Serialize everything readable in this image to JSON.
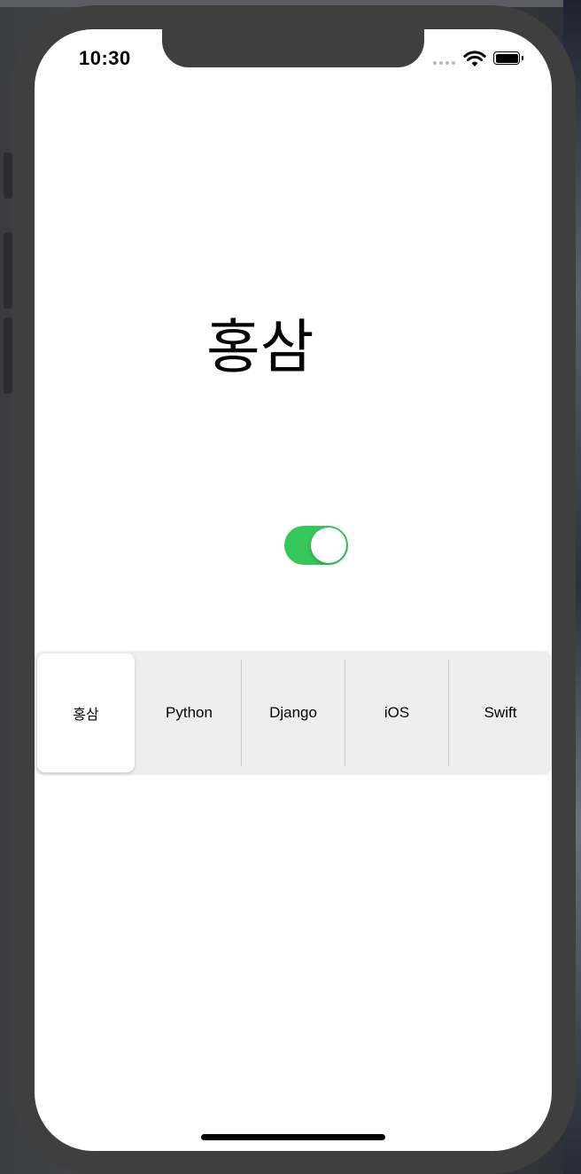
{
  "status_bar": {
    "time": "10:30"
  },
  "main": {
    "title_label": "홍삼",
    "toggle": {
      "on": true,
      "on_color": "#34c759"
    }
  },
  "segmented_control": {
    "selected_index": 0,
    "segments": [
      "홍삼",
      "Python",
      "Django",
      "iOS",
      "Swift"
    ]
  }
}
